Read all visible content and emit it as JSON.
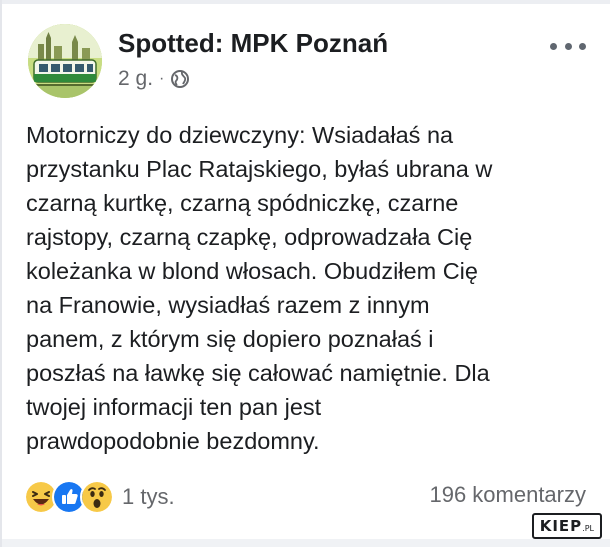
{
  "post": {
    "page_name": "Spotted: MPK Poznań",
    "time": "2 g.",
    "separator": "·",
    "privacy_icon": "globe-icon",
    "more_icon": "more-horizontal-icon",
    "text_lines": [
      "Motorniczy do dziewczyny: Wsiadałaś na",
      "przystanku Plac Ratajskiego, byłaś ubrana w",
      "czarną kurtkę, czarną spódniczkę, czarne",
      "rajstopy, czarną czapkę, odprowadzała Cię",
      "koleżanka w blond włosach. Obudziłem Cię",
      "na Franowie, wysiadłaś razem z innym",
      "panem, z którym się dopiero poznałaś i",
      "poszłaś na ławkę się całować namiętnie. Dla",
      "twojej informacji ten pan jest",
      "prawdopodobnie bezdomny."
    ]
  },
  "footer": {
    "reactions": [
      "haha-reaction-icon",
      "like-reaction-icon",
      "wow-reaction-icon"
    ],
    "reaction_count": "1 tys.",
    "comments": "196 komentarzy"
  },
  "watermark": {
    "brand": "KIEP",
    "suffix": ".PL"
  },
  "colors": {
    "text": "#1c1e21",
    "secondary": "#65676b",
    "like_blue": "#1877f2",
    "emoji_yellow": "#f7c948"
  }
}
